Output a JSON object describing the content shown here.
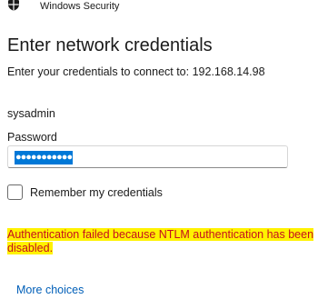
{
  "window": {
    "title": "Windows Security",
    "icon": "shield-icon"
  },
  "dialog": {
    "heading": "Enter network credentials",
    "subtitle": "Enter your credentials to connect to: 192.168.14.98",
    "username": "sysadmin",
    "password_label": "Password",
    "password_value": "●●●●●●●●●●●",
    "remember_label": "Remember my credentials",
    "remember_checked": false,
    "error_message": "Authentication failed because NTLM authentication has been disabled.",
    "more_choices": "More choices"
  },
  "colors": {
    "error_text": "#c50f1f",
    "highlight": "#fff200",
    "link": "#005fb8",
    "selection": "#0078d7"
  }
}
